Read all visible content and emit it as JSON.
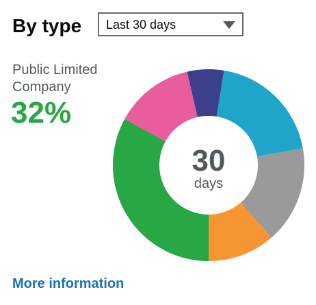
{
  "header": {
    "title": "By type",
    "period_select": {
      "selected": "Last 30 days"
    }
  },
  "highlight": {
    "label": "Public Limited Company",
    "percent": "32%"
  },
  "chart_data": {
    "type": "pie",
    "donut": true,
    "center_value": "30",
    "center_unit": "days",
    "categories": [
      "Public Limited Company",
      "",
      "",
      "",
      "",
      ""
    ],
    "values": [
      32,
      13,
      6,
      19,
      16,
      11
    ],
    "colors": [
      "#28a745",
      "#e85d9c",
      "#3b3f8c",
      "#1fa5c9",
      "#9a9a9a",
      "#f79533"
    ],
    "legend": false
  },
  "footer": {
    "more_link": "More information"
  }
}
